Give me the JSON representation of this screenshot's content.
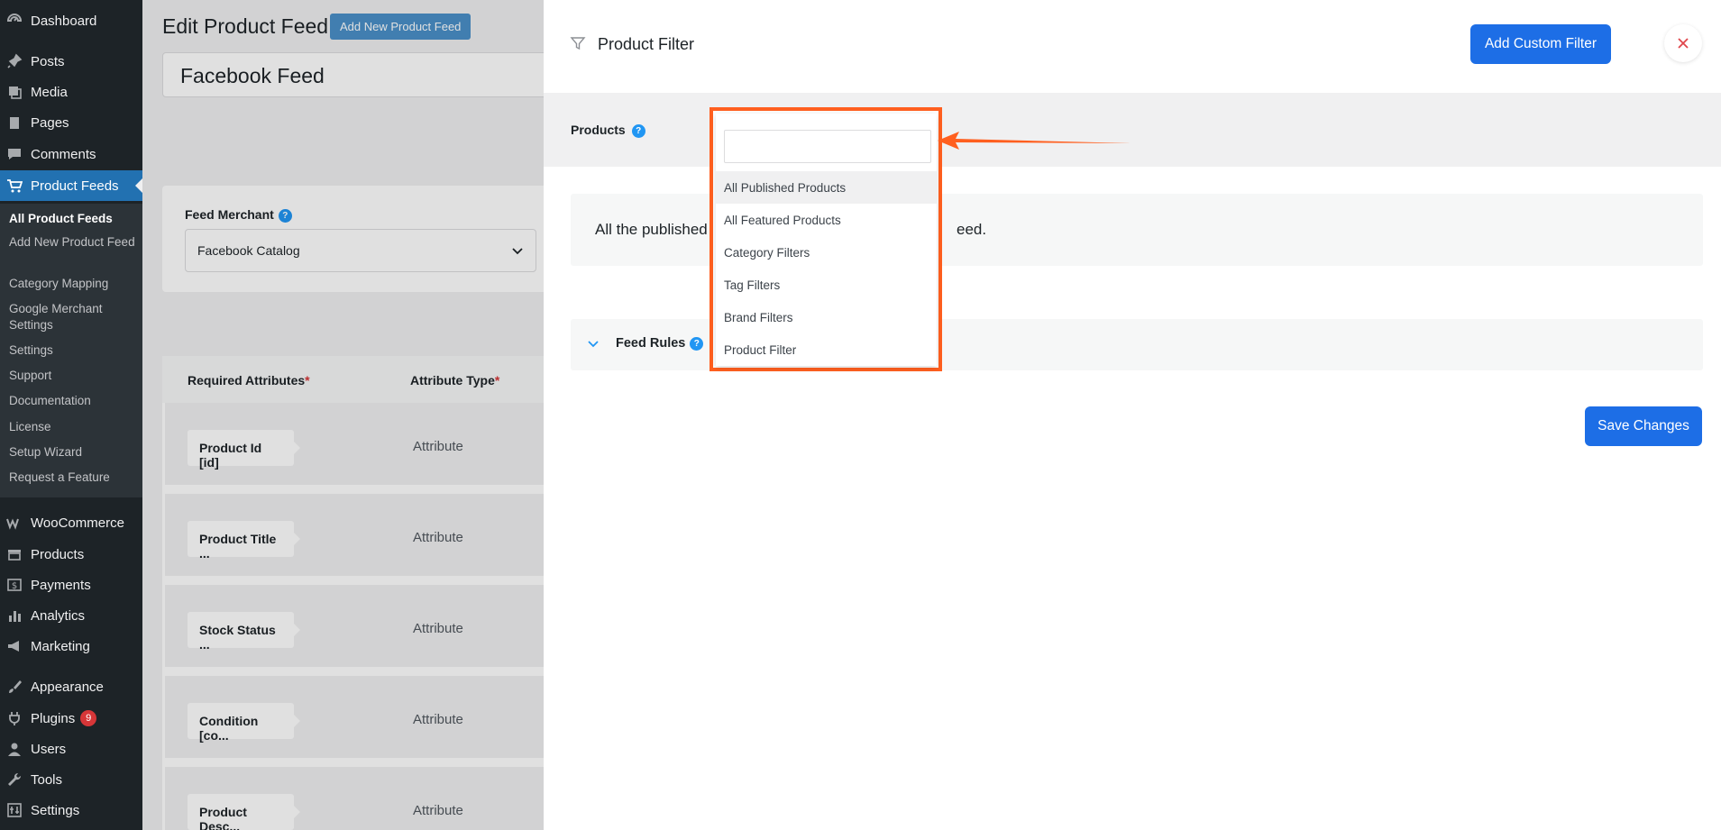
{
  "sidebar": {
    "top_items": [
      {
        "label": "Dashboard",
        "icon": "dashboard-icon"
      },
      {
        "label": "Posts",
        "icon": "pin-icon"
      },
      {
        "label": "Media",
        "icon": "media-icon"
      },
      {
        "label": "Pages",
        "icon": "page-icon"
      },
      {
        "label": "Comments",
        "icon": "comment-icon"
      }
    ],
    "active_item": {
      "label": "Product Feeds",
      "icon": "cart-icon"
    },
    "submenu": [
      "All Product Feeds",
      "Add New Product Feed",
      "Category Mapping",
      "Google Merchant Settings",
      "Settings",
      "Support",
      "Documentation",
      "License",
      "Setup Wizard",
      "Request a Feature"
    ],
    "bottom_items": [
      {
        "label": "WooCommerce",
        "icon": "woocommerce-icon"
      },
      {
        "label": "Products",
        "icon": "box-icon"
      },
      {
        "label": "Payments",
        "icon": "dollar-icon"
      },
      {
        "label": "Analytics",
        "icon": "bar-chart-icon"
      },
      {
        "label": "Marketing",
        "icon": "megaphone-icon"
      },
      {
        "label": "Appearance",
        "icon": "brush-icon"
      },
      {
        "label": "Plugins",
        "icon": "plug-icon",
        "badge": "9"
      },
      {
        "label": "Users",
        "icon": "user-icon"
      },
      {
        "label": "Tools",
        "icon": "wrench-icon"
      },
      {
        "label": "Settings",
        "icon": "settings-icon"
      }
    ]
  },
  "page": {
    "title": "Edit Product Feed",
    "add_new_label": "Add New Product Feed",
    "feed_name": "Facebook Feed",
    "merchant_label": "Feed Merchant",
    "merchant_value": "Facebook Catalog",
    "table_headers": [
      "Required Attributes",
      "Attribute Type"
    ],
    "attributes": [
      {
        "name": "Product Id [id]",
        "type": "Attribute"
      },
      {
        "name": "Product Title ...",
        "type": "Attribute"
      },
      {
        "name": "Stock Status ...",
        "type": "Attribute"
      },
      {
        "name": "Condition [co...",
        "type": "Attribute"
      },
      {
        "name": "Product Desc...",
        "type": "Attribute"
      }
    ]
  },
  "drawer": {
    "title": "Product Filter",
    "custom_filter_label": "Add Custom Filter",
    "close_icon": "close-icon",
    "products_label": "Products",
    "description_left": "All the published",
    "description_right": "eed.",
    "feed_rules_label": "Feed Rules",
    "save_label": "Save Changes"
  },
  "dropdown": {
    "search_value": "",
    "options": [
      "All Published Products",
      "All Featured Products",
      "Category Filters",
      "Tag Filters",
      "Brand Filters",
      "Product Filter"
    ],
    "highlighted_index": 0
  },
  "colors": {
    "accent": "#1d6ee6",
    "annotation": "#ff5f1f",
    "sidebar_bg": "#1d2327",
    "active_menu": "#2271b1"
  }
}
